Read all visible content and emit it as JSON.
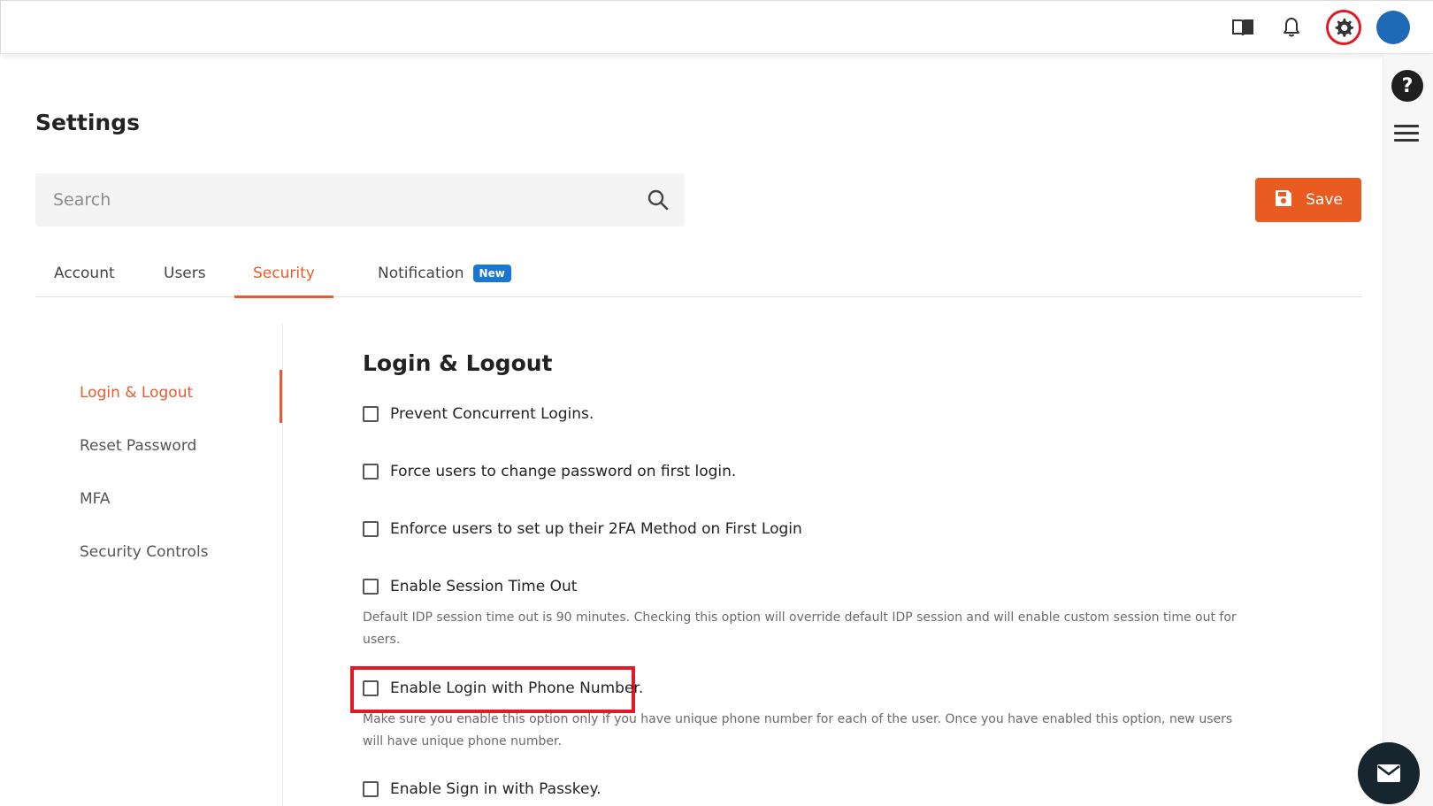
{
  "topbar": {
    "icons": [
      "book-icon",
      "bell-icon",
      "gear-icon",
      "avatar"
    ],
    "avatar_color": "#1e6ab7",
    "highlight_color": "#e01b24"
  },
  "page": {
    "title": "Settings"
  },
  "search": {
    "placeholder": "Search",
    "value": ""
  },
  "toolbar": {
    "save_label": "Save",
    "save_color": "#ea5b22"
  },
  "tabs": [
    {
      "label": "Account"
    },
    {
      "label": "Users"
    },
    {
      "label": "Security",
      "active": true
    },
    {
      "label": "Notification",
      "badge": "New"
    }
  ],
  "sidenav": {
    "items": [
      {
        "label": "Login & Logout",
        "active": true
      },
      {
        "label": "Reset Password"
      },
      {
        "label": "MFA"
      },
      {
        "label": "Security Controls"
      }
    ]
  },
  "section": {
    "title": "Login & Logout",
    "options": [
      {
        "label": "Prevent Concurrent Logins.",
        "checked": false
      },
      {
        "label": "Force users to change password on first login.",
        "checked": false
      },
      {
        "label": "Enforce users to set up their 2FA Method on First Login",
        "checked": false
      },
      {
        "label": "Enable Session Time Out",
        "checked": false,
        "help": "Default IDP session time out is 90 minutes. Checking this option will override default IDP session and will enable custom session time out for users."
      },
      {
        "label": "Enable Login with Phone Number.",
        "checked": false,
        "highlighted": true,
        "help": "Make sure you enable this option only if you have unique phone number for each of the user. Once you have enabled this option, new users will have unique phone number."
      },
      {
        "label": "Enable Sign in with Passkey.",
        "checked": false
      }
    ]
  },
  "accent_color": "#e65c2c"
}
